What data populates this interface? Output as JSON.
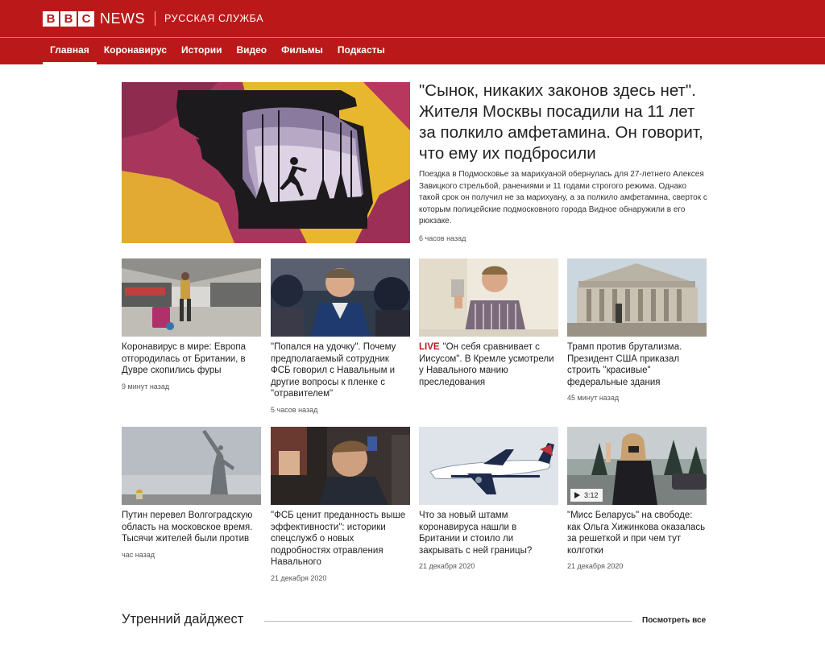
{
  "header": {
    "logo_letters": [
      "B",
      "B",
      "C"
    ],
    "logo_news": "NEWS",
    "service": "РУССКАЯ СЛУЖБА",
    "brand_color": "#bb1919"
  },
  "nav": [
    {
      "label": "Главная",
      "active": true
    },
    {
      "label": "Коронавирус"
    },
    {
      "label": "Истории"
    },
    {
      "label": "Видео"
    },
    {
      "label": "Фильмы"
    },
    {
      "label": "Подкасты"
    }
  ],
  "hero": {
    "title": "\"Сынок, никаких законов здесь нет\". Жителя Москвы посадили на 11 лет за полкило амфетамина. Он говорит, что ему их подбросили",
    "summary": "Поездка в Подмосковье за марихуаной обернулась для 27-летнего Алексея Завицкого стрельбой, ранениями и 11 годами строгого режима. Однако такой срок он получил не за марихуану, а за полкило амфетамина, сверток с которым полицейские подмосковного города Видное обнаружили в его рюкзаке.",
    "time": "6 часов назад"
  },
  "cards": [
    {
      "title": "Коронавирус в мире: Европа отгородилась от Британии, в Дувре скопились фуры",
      "time": "9 минут назад"
    },
    {
      "title": "\"Попался на удочку\". Почему предполагаемый сотрудник ФСБ говорил с Навальным и другие вопросы к пленке с \"отравителем\"",
      "time": "5 часов назад"
    },
    {
      "live": "LIVE",
      "title": "\"Он себя сравнивает с Иисусом\". В Кремле усмотрели у Навального манию преследования",
      "time": ""
    },
    {
      "title": "Трамп против брутализма. Президент США приказал строить \"красивые\" федеральные здания",
      "time": "45 минут назад"
    },
    {
      "title": "Путин перевел Волгоградскую область на московское время. Тысячи жителей были против",
      "time": "час назад"
    },
    {
      "title": "\"ФСБ ценит преданность выше эффективности\": историки спецслужб о новых подробностях отравления Навального",
      "time": "21 декабря 2020"
    },
    {
      "title": "Что за новый штамм коронавируса нашли в Британии и стоило ли закрывать с ней границы?",
      "time": "21 декабря 2020"
    },
    {
      "title": "\"Мисс Беларусь\" на свободе: как Ольга Хижинкова оказалась за решеткой и при чем тут колготки",
      "time": "21 декабря 2020",
      "video_duration": "3:12"
    }
  ],
  "digest": {
    "title": "Утренний дайджест",
    "see_all": "Посмотреть все"
  }
}
